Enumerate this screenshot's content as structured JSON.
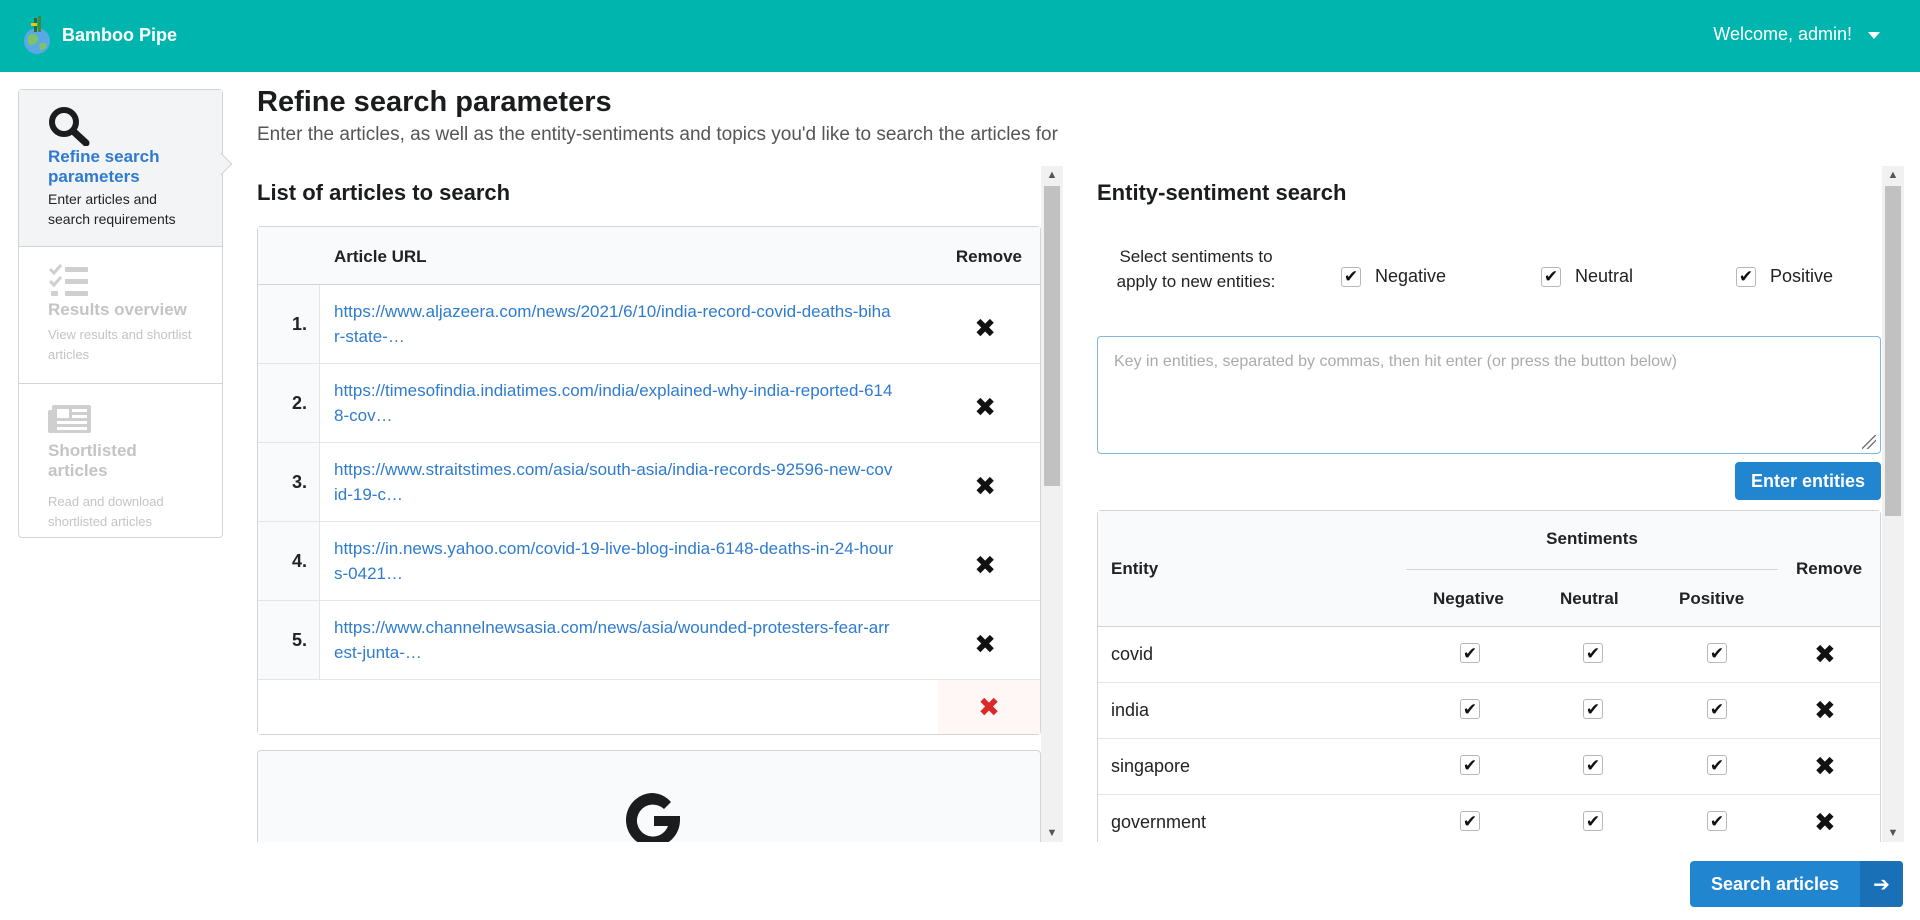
{
  "header": {
    "brand": "Bamboo Pipe",
    "welcome": "Welcome, admin!"
  },
  "steps": [
    {
      "title": "Refine search parameters",
      "desc": "Enter articles and search requirements",
      "icon": "search-icon",
      "active": true
    },
    {
      "title": "Results overview",
      "desc": "View results and shortlist articles",
      "icon": "tasks-icon",
      "active": false
    },
    {
      "title": "Shortlisted articles",
      "desc": "Read and download shortlisted articles",
      "icon": "newspaper-icon",
      "active": false
    }
  ],
  "page": {
    "title": "Refine search parameters",
    "subtitle": "Enter the articles, as well as the entity-sentiments and topics you'd like to search the articles for"
  },
  "articles": {
    "section_title": "List of articles to search",
    "col_url": "Article URL",
    "col_remove": "Remove",
    "rows": [
      {
        "num": "1.",
        "url": "https://www.aljazeera.com/news/2021/6/10/india-record-covid-deaths-bihar-state-…"
      },
      {
        "num": "2.",
        "url": "https://timesofindia.indiatimes.com/india/explained-why-india-reported-6148-cov…"
      },
      {
        "num": "3.",
        "url": "https://www.straitstimes.com/asia/south-asia/india-records-92596-new-covid-19-c…"
      },
      {
        "num": "4.",
        "url": "https://in.news.yahoo.com/covid-19-live-blog-india-6148-deaths-in-24-hours-0421…"
      },
      {
        "num": "5.",
        "url": "https://www.channelnewsasia.com/news/asia/wounded-protesters-fear-arrest-junta-…"
      }
    ],
    "new_url_value": ""
  },
  "entity": {
    "section_title": "Entity-sentiment search",
    "sentiment_label": "Select sentiments to apply to new entities:",
    "options": [
      {
        "label": "Negative",
        "checked": true
      },
      {
        "label": "Neutral",
        "checked": true
      },
      {
        "label": "Positive",
        "checked": true
      }
    ],
    "input_placeholder": "Key in entities, separated by commas, then hit enter (or press the button below)",
    "enter_button": "Enter entities",
    "table": {
      "col_entity": "Entity",
      "col_sentiments": "Sentiments",
      "col_negative": "Negative",
      "col_neutral": "Neutral",
      "col_positive": "Positive",
      "col_remove": "Remove",
      "rows": [
        {
          "name": "covid",
          "negative": true,
          "neutral": true,
          "positive": true
        },
        {
          "name": "india",
          "negative": true,
          "neutral": true,
          "positive": true
        },
        {
          "name": "singapore",
          "negative": true,
          "neutral": true,
          "positive": true
        },
        {
          "name": "government",
          "negative": true,
          "neutral": true,
          "positive": true
        }
      ]
    }
  },
  "search_button": "Search articles",
  "colors": {
    "header": "#00b5ad",
    "primary": "#2185d0",
    "link": "#2e7bd0",
    "danger": "#db2828"
  }
}
